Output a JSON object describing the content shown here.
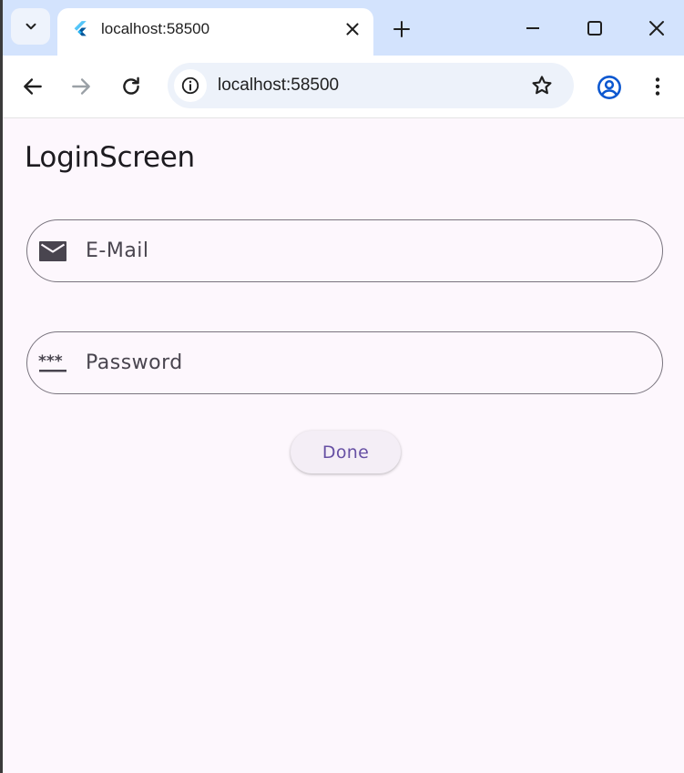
{
  "browser": {
    "tab": {
      "title": "localhost:58500",
      "favicon": "flutter-icon"
    },
    "toolbar": {
      "url": "localhost:58500"
    },
    "icons": {
      "tab_search": "chevron-down-icon",
      "close_tab": "close-icon",
      "new_tab": "plus-icon",
      "minimize": "minimize-icon",
      "maximize": "maximize-icon",
      "close_window": "close-icon",
      "back": "back-arrow-icon",
      "forward": "forward-arrow-icon",
      "reload": "reload-icon",
      "site_info": "info-icon",
      "bookmark": "star-icon",
      "profile": "profile-icon",
      "menu": "more-vert-icon"
    },
    "colors": {
      "tabstrip": "#d3e3fd",
      "omnibox": "#edf2fa"
    }
  },
  "app": {
    "title": "LoginScreen",
    "fields": {
      "email": {
        "placeholder": "E-Mail",
        "value": "",
        "icon": "mail-icon"
      },
      "password": {
        "placeholder": "Password",
        "value": "",
        "icon": "password-icon"
      }
    },
    "done_label": "Done",
    "colors": {
      "background": "#fdf7fd",
      "primary": "#6750a4",
      "outline": "#79747e"
    }
  }
}
